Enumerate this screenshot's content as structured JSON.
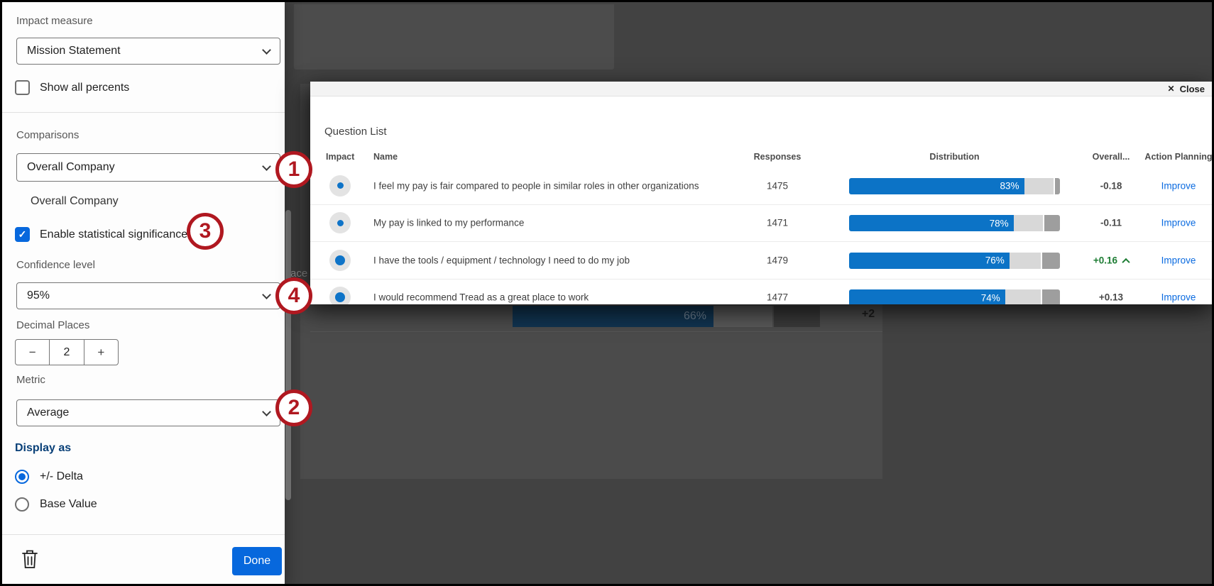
{
  "annotations": {
    "badges": [
      "1",
      "3",
      "4",
      "2"
    ]
  },
  "colors": {
    "accent_blue": "#0768dd",
    "bar_blue": "#0c73c6",
    "link_blue": "#0b6be0",
    "positive_green": "#1e7d34",
    "badge_red": "#b01820",
    "display_as_navy": "#094078"
  },
  "left_panel": {
    "impact_measure": {
      "label": "Impact measure",
      "value": "Mission Statement"
    },
    "show_all_percents": {
      "label": "Show all percents",
      "checked": false
    },
    "comparisons": {
      "label": "Comparisons",
      "value": "Overall Company",
      "selected_item": "Overall Company"
    },
    "enable_stat_sig": {
      "label": "Enable statistical significance",
      "checked": true
    },
    "confidence": {
      "label": "Confidence level",
      "value": "95%"
    },
    "decimal_places": {
      "label": "Decimal Places",
      "value": "2",
      "minus": "−",
      "plus": "+"
    },
    "metric": {
      "label": "Metric",
      "value": "Average"
    },
    "display_as": {
      "label": "Display as",
      "options": [
        {
          "label": "+/- Delta",
          "selected": true
        },
        {
          "label": "Base Value",
          "selected": false
        }
      ]
    },
    "done_label": "Done"
  },
  "question_list": {
    "close_x": "✕",
    "close_label": "Close",
    "title": "Question List",
    "columns": [
      "Impact",
      "Name",
      "Responses",
      "Distribution",
      "Overall...",
      "Action Planning"
    ],
    "rows": [
      {
        "impact": "low",
        "name": "I feel my pay is fair compared to people in similar roles in other organizations",
        "responses": "1475",
        "pct": "83%",
        "segments": [
          83,
          14,
          3
        ],
        "overall": "-0.18",
        "overall_positive": false,
        "action": "Improve"
      },
      {
        "impact": "low",
        "name": "My pay is linked to my performance",
        "responses": "1471",
        "pct": "78%",
        "segments": [
          78,
          14,
          8
        ],
        "overall": "-0.11",
        "overall_positive": false,
        "action": "Improve"
      },
      {
        "impact": "high",
        "name": "I have the tools / equipment / technology I need to do my job",
        "responses": "1479",
        "pct": "76%",
        "segments": [
          76,
          15,
          9
        ],
        "overall": "+0.16",
        "overall_positive": true,
        "action": "Improve"
      },
      {
        "impact": "high",
        "name": "I would recommend Tread as a great place to work",
        "responses": "1477",
        "pct": "74%",
        "segments": [
          74,
          17,
          9
        ],
        "overall": "+0.13",
        "overall_positive": false,
        "action": "Improve"
      }
    ]
  },
  "background": {
    "dim_row": {
      "pct_label": "66%",
      "extra": "+2"
    },
    "text_fragment": "ace"
  }
}
